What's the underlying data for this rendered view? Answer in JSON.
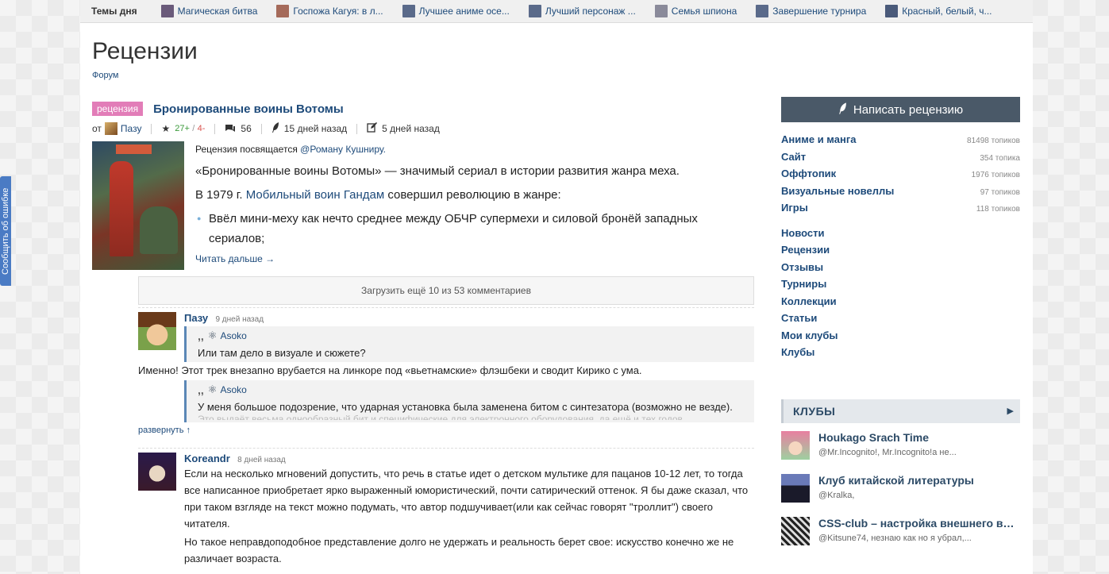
{
  "feedback": "Сообщить об ошибке",
  "topbar": {
    "label": "Темы дня",
    "topics": [
      {
        "label": "Магическая битва",
        "color": "#6a5a7a"
      },
      {
        "label": "Госпожа Кагуя: в л...",
        "color": "#a56a5a"
      },
      {
        "label": "Лучшее аниме осе...",
        "color": "#5a6a8a"
      },
      {
        "label": "Лучший персонаж ...",
        "color": "#5a6a8a"
      },
      {
        "label": "Семья шпиона",
        "color": "#8a8a9a"
      },
      {
        "label": "Завершение турнира",
        "color": "#5a6a8a"
      },
      {
        "label": "Красный, белый, ч...",
        "color": "#4a5a7a"
      }
    ]
  },
  "page": {
    "title": "Рецензии",
    "breadcrumb": "Форум"
  },
  "post": {
    "tag": "рецензия",
    "title": "Бронированные воины Вотомы",
    "by": "от",
    "author": "Пазу",
    "score_pos": "27+",
    "score_sep": "/",
    "score_neg": "4-",
    "comments_count": "56",
    "created": "15 дней назад",
    "edited": "5 дней назад",
    "intro_prefix": "Рецензия посвящается",
    "intro_link": "@Роману Кушниру.",
    "p1": "«Бронированные воины Вотомы» — значимый сериал в истории развития жанра меха.",
    "p2_prefix": "В 1979 г.",
    "p2_link": "Мобильный воин Гандам",
    "p2_suffix": "совершил революцию в жанре:",
    "bullet1": "Ввёл мини-меху как нечто среднее между ОБЧР супермехи и силовой бронёй западных сериалов;",
    "read_more": "Читать дальше →"
  },
  "comments": {
    "load_more": "Загрузить ещё 10 из 53 комментариев",
    "items": [
      {
        "author": "Пазу",
        "time": "9 дней назад",
        "quote1_author": "Asoko",
        "quote1_text": "Или там дело в визуале и сюжете?",
        "text1": "Именно! Этот трек внезапно врубается на линкоре под «вьетнамские» флэшбеки и сводит Кирико с ума.",
        "quote2_author": "Asoko",
        "quote2_text": "У меня большое подозрение, что ударная установка была заменена битом с синтезатора (возможно не везде).",
        "quote2_fade": "Это выдаёт весьма однообразный бит и специфические для электронного оборудования, да ещё и тех годов",
        "expand": "развернуть ↑"
      },
      {
        "author": "Koreandr",
        "time": "8 дней назад",
        "text1": "Если на несколько мгновений допустить, что речь в статье идет о детском мультике для пацанов 10-12 лет, то тогда все написанное приобретает ярко выраженный юмористический, почти сатирический оттенок. Я бы даже сказал, что при таком взгляде на текст можно подумать, что автор подшучивает(или как сейчас говорят \"троллит\") своего читателя.",
        "text2": "Но такое неправдоподобное представление долго не удержать и реальность берет свое: искусство конечно же не различает возраста."
      }
    ]
  },
  "sidebar": {
    "write_button": "Написать рецензию",
    "forums": [
      {
        "name": "Аниме и манга",
        "count": "81498 топиков"
      },
      {
        "name": "Сайт",
        "count": "354 топика"
      },
      {
        "name": "Оффтопик",
        "count": "1976 топиков"
      },
      {
        "name": "Визуальные новеллы",
        "count": "97 топиков"
      },
      {
        "name": "Игры",
        "count": "118 топиков"
      }
    ],
    "links": [
      "Новости",
      "Рецензии",
      "Отзывы",
      "Турниры",
      "Коллекции",
      "Статьи",
      "Мои клубы",
      "Клубы"
    ],
    "clubs_title": "КЛУБЫ",
    "clubs": [
      {
        "name": "Houkago Srach Time",
        "members": "@Mr.Incognito!, Mr.Incognito!а не..."
      },
      {
        "name": "Клуб китайской литературы",
        "members": "@Kralka,"
      },
      {
        "name": "CSS-club – настройка внешнего вида",
        "members": "@Kitsune74, незнаю как но я убрал,..."
      }
    ]
  }
}
